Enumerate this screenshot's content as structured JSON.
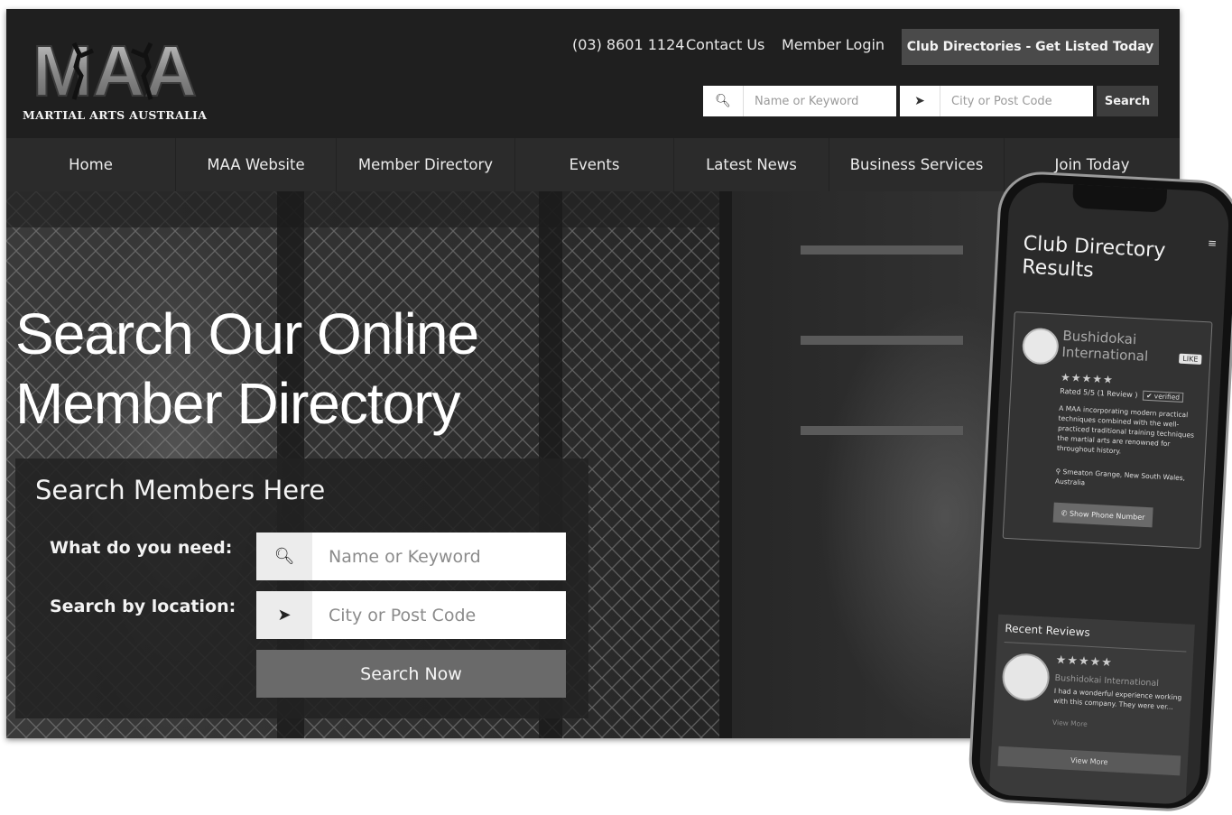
{
  "brand": {
    "logo_text": "MAA",
    "tagline": "MARTIAL ARTS AUSTRALIA"
  },
  "header": {
    "phone": "(03) 8601 1124",
    "contact": "Contact Us",
    "login": "Member Login",
    "cta": "Club Directories - Get Listed Today",
    "search": {
      "keyword_placeholder": "Name or Keyword",
      "location_placeholder": "City or Post Code",
      "button": "Search"
    }
  },
  "nav": {
    "items": [
      {
        "label": "Home"
      },
      {
        "label": "MAA Website"
      },
      {
        "label": "Member Directory"
      },
      {
        "label": "Events"
      },
      {
        "label": "Latest News"
      },
      {
        "label": "Business Services"
      },
      {
        "label": "Join Today"
      }
    ]
  },
  "hero": {
    "headline_line1": "Search Our Online",
    "headline_line2": "Member Directory",
    "panel": {
      "title": "Search Members Here",
      "need_label": "What do you need:",
      "location_label": "Search by location:",
      "keyword_placeholder": "Name or Keyword",
      "location_placeholder": "City or Post Code",
      "button": "Search Now"
    }
  },
  "phone": {
    "menu_icon": "hamburger-icon",
    "title_line1": "Club Directory",
    "title_line2": "Results",
    "listing": {
      "name_line1": "Bushidokai",
      "name_line2": "International",
      "like": "LIKE",
      "stars": "★★★★★",
      "rating_text": "Rated 5/5 (1 Review )",
      "verified": "✔ verified",
      "description": "A MAA incorporating modern practical techniques combined with the well-practiced traditional training techniques the martial arts are renowned for throughout history.",
      "location": "⚲ Smeaton Grange, New South Wales, Australia",
      "phone_button": "✆ Show Phone Number"
    },
    "reviews": {
      "heading": "Recent Reviews",
      "stars": "★★★★★",
      "club": "Bushidokai International",
      "text": "I had a wonderful experience working with this company. They were ver...",
      "view_more_link": "View More",
      "view_more_button": "View More"
    }
  },
  "colors": {
    "header_bg": "#1f1f1f",
    "nav_bg": "#2b2b2b",
    "cta_bg": "#4a4a4a",
    "button_bg": "#6a6a6a"
  }
}
